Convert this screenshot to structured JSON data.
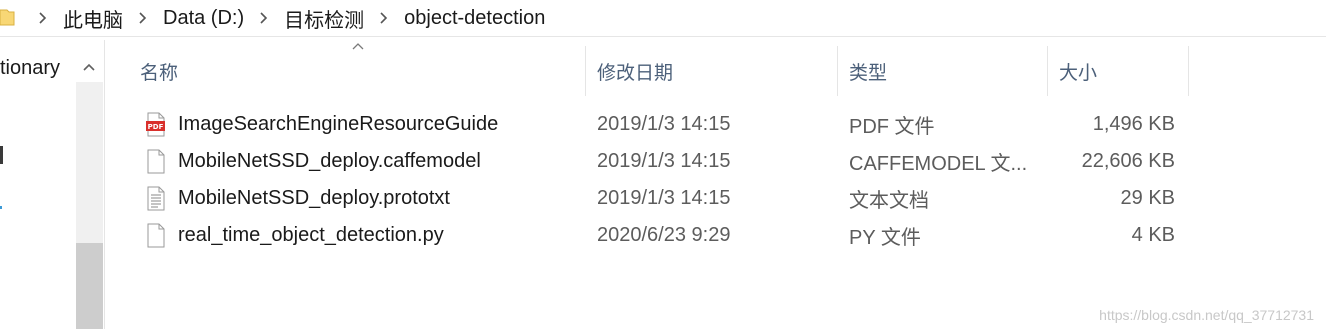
{
  "address_bar": {
    "folder_icon": "folder-icon",
    "crumbs": [
      "此电脑",
      "Data (D:)",
      "目标检测",
      "object-detection"
    ]
  },
  "nav_pane": {
    "visible_text": "tionary"
  },
  "columns": {
    "name": "名称",
    "date": "修改日期",
    "type": "类型",
    "size": "大小",
    "sorted_by": "name"
  },
  "files": [
    {
      "icon": "pdf-file-icon",
      "name": "ImageSearchEngineResourceGuide",
      "date": "2019/1/3 14:15",
      "type": "PDF 文件",
      "size": "1,496 KB"
    },
    {
      "icon": "blank-file-icon",
      "name": "MobileNetSSD_deploy.caffemodel",
      "date": "2019/1/3 14:15",
      "type": "CAFFEMODEL 文...",
      "size": "22,606 KB"
    },
    {
      "icon": "text-file-icon",
      "name": "MobileNetSSD_deploy.prototxt",
      "date": "2019/1/3 14:15",
      "type": "文本文档",
      "size": "29 KB"
    },
    {
      "icon": "blank-file-icon",
      "name": "real_time_object_detection.py",
      "date": "2020/6/23 9:29",
      "type": "PY 文件",
      "size": "4 KB"
    }
  ],
  "watermark": "https://blog.csdn.net/qq_37712731",
  "colors": {
    "header_text": "#4c607a",
    "detail_text": "#5c5c5c",
    "folder_yellow": "#f8d775",
    "pdf_red": "#d9302c"
  }
}
